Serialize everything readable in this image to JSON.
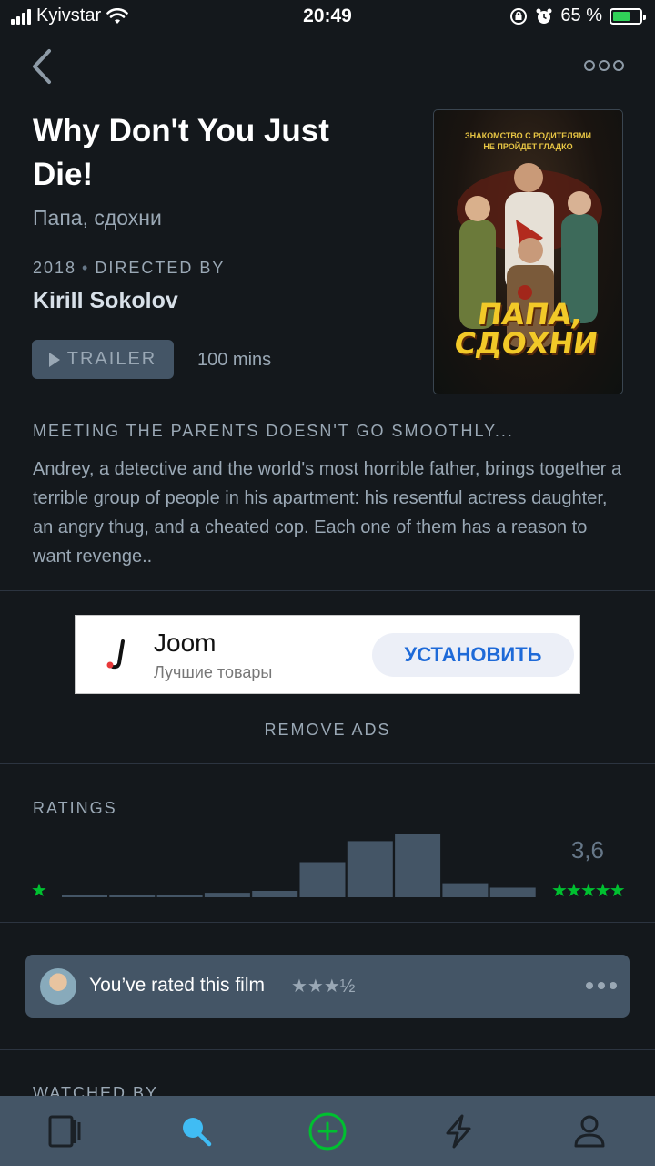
{
  "status_bar": {
    "carrier": "Kyivstar",
    "time": "20:49",
    "battery_percent": "65 %",
    "battery_level": 0.65
  },
  "nav": {
    "back_icon": "chevron-left-icon",
    "more_icon": "more-horizontal-icon"
  },
  "film": {
    "title": "Why Don't You Just Die!",
    "original_title": "Папа, сдохни",
    "year": "2018",
    "directed_by_label": "DIRECTED BY",
    "director": "Kirill Sokolov",
    "trailer_label": "TRAILER",
    "runtime": "100 mins",
    "tagline": "MEETING THE PARENTS DOESN'T GO SMOOTHLY...",
    "description": "Andrey, a detective and the world's most horrible father, brings together a terrible group of people in his apartment: his resentful actress daughter, an angry thug, and a cheated cop. Each one of them has a reason to want revenge.."
  },
  "poster": {
    "tagline_line1": "ЗНАКОМСТВО С РОДИТЕЛЯМИ",
    "tagline_line2": "НЕ ПРОЙДЕТ ГЛАДКО",
    "title_line1": "ПАПА,",
    "title_line2": "СДОХНИ"
  },
  "ad": {
    "app_name": "Joom",
    "app_tagline": "Лучшие товары",
    "cta": "УСТАНОВИТЬ",
    "remove_ads": "REMOVE ADS"
  },
  "ratings": {
    "label": "RATINGS",
    "average": "3,6",
    "min_star": "★",
    "max_stars": "★★★★★",
    "histogram_share": [
      0.02,
      0.02,
      0.02,
      0.07,
      0.1,
      0.55,
      0.88,
      1.0,
      0.22,
      0.15
    ]
  },
  "your_rating": {
    "text": "You’ve rated this film",
    "stars": "★★★½"
  },
  "watched_by": "WATCHED BY",
  "tabs": [
    {
      "name": "tab-films",
      "icon": "films-icon"
    },
    {
      "name": "tab-search",
      "icon": "search-icon"
    },
    {
      "name": "tab-add",
      "icon": "add-icon"
    },
    {
      "name": "tab-activity",
      "icon": "activity-icon"
    },
    {
      "name": "tab-profile",
      "icon": "profile-icon"
    }
  ],
  "colors": {
    "background": "#14181c",
    "accent_green": "#00c030",
    "search_blue": "#40bcf4",
    "slate": "#445566"
  }
}
